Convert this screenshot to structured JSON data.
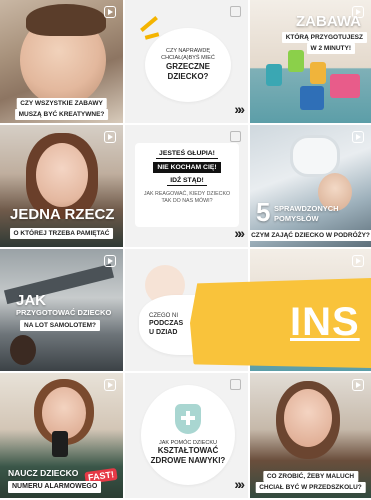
{
  "posts": [
    {
      "line1": "CZY WSZYSTKIE ZABAWY",
      "line2": "MUSZĄ BYĆ KREATYWNE?"
    },
    {
      "line1": "CZY NAPRAWDĘ",
      "line2": "CHCIAŁ(A)BYŚ MIEĆ",
      "bold": "GRZECZNE DZIECKO?"
    },
    {
      "title": "ZABAWA",
      "sub1": "KTÓRĄ PRZYGOTUJESZ",
      "sub2": "W 2 MINUTY!"
    },
    {
      "title": "JEDNA RZECZ",
      "sub": "O KTÓREJ TRZEBA PAMIĘTAĆ"
    },
    {
      "line1": "JESTEŚ GŁUPIA!",
      "line2": "NIE KOCHAM CIĘ!",
      "line3": "IDŹ STĄD!",
      "q": "JAK REAGOWAĆ, KIEDY DZIECKO TAK DO NAS MÓWI?"
    },
    {
      "num": "5",
      "title1": "SPRAWDZONYCH",
      "title2": "POMYSŁÓW",
      "sub": "CZYM ZAJĄĆ DZIECKO W PODRÓŻY?"
    },
    {
      "title1": "JAK",
      "title2": "PRZYGOTOWAĆ DZIECKO",
      "sub": "NA LOT SAMOLOTEM?"
    },
    {
      "line1": "CZEGO NI",
      "line2": "PODCZAS",
      "line3": "U DZIAD"
    },
    {},
    {
      "title": "NAUCZ DZIECKO",
      "sub": "NUMERU ALARMOWEGO",
      "badge": "FAST!"
    },
    {
      "line1": "JAK POMÓC DZIECKU",
      "bold": "KSZTAŁTOWAĆ",
      "bold2": "ZDROWE NAWYKI?"
    },
    {
      "line1": "CO ZROBIĆ, ŻEBY MALUCH",
      "line2": "CHCIAŁ BYĆ W PRZEDSZKOLU?"
    }
  ],
  "banner": {
    "text": "INS"
  },
  "icons": {
    "reel": "reel-icon",
    "square": "square-icon",
    "chevrons": "»»"
  }
}
